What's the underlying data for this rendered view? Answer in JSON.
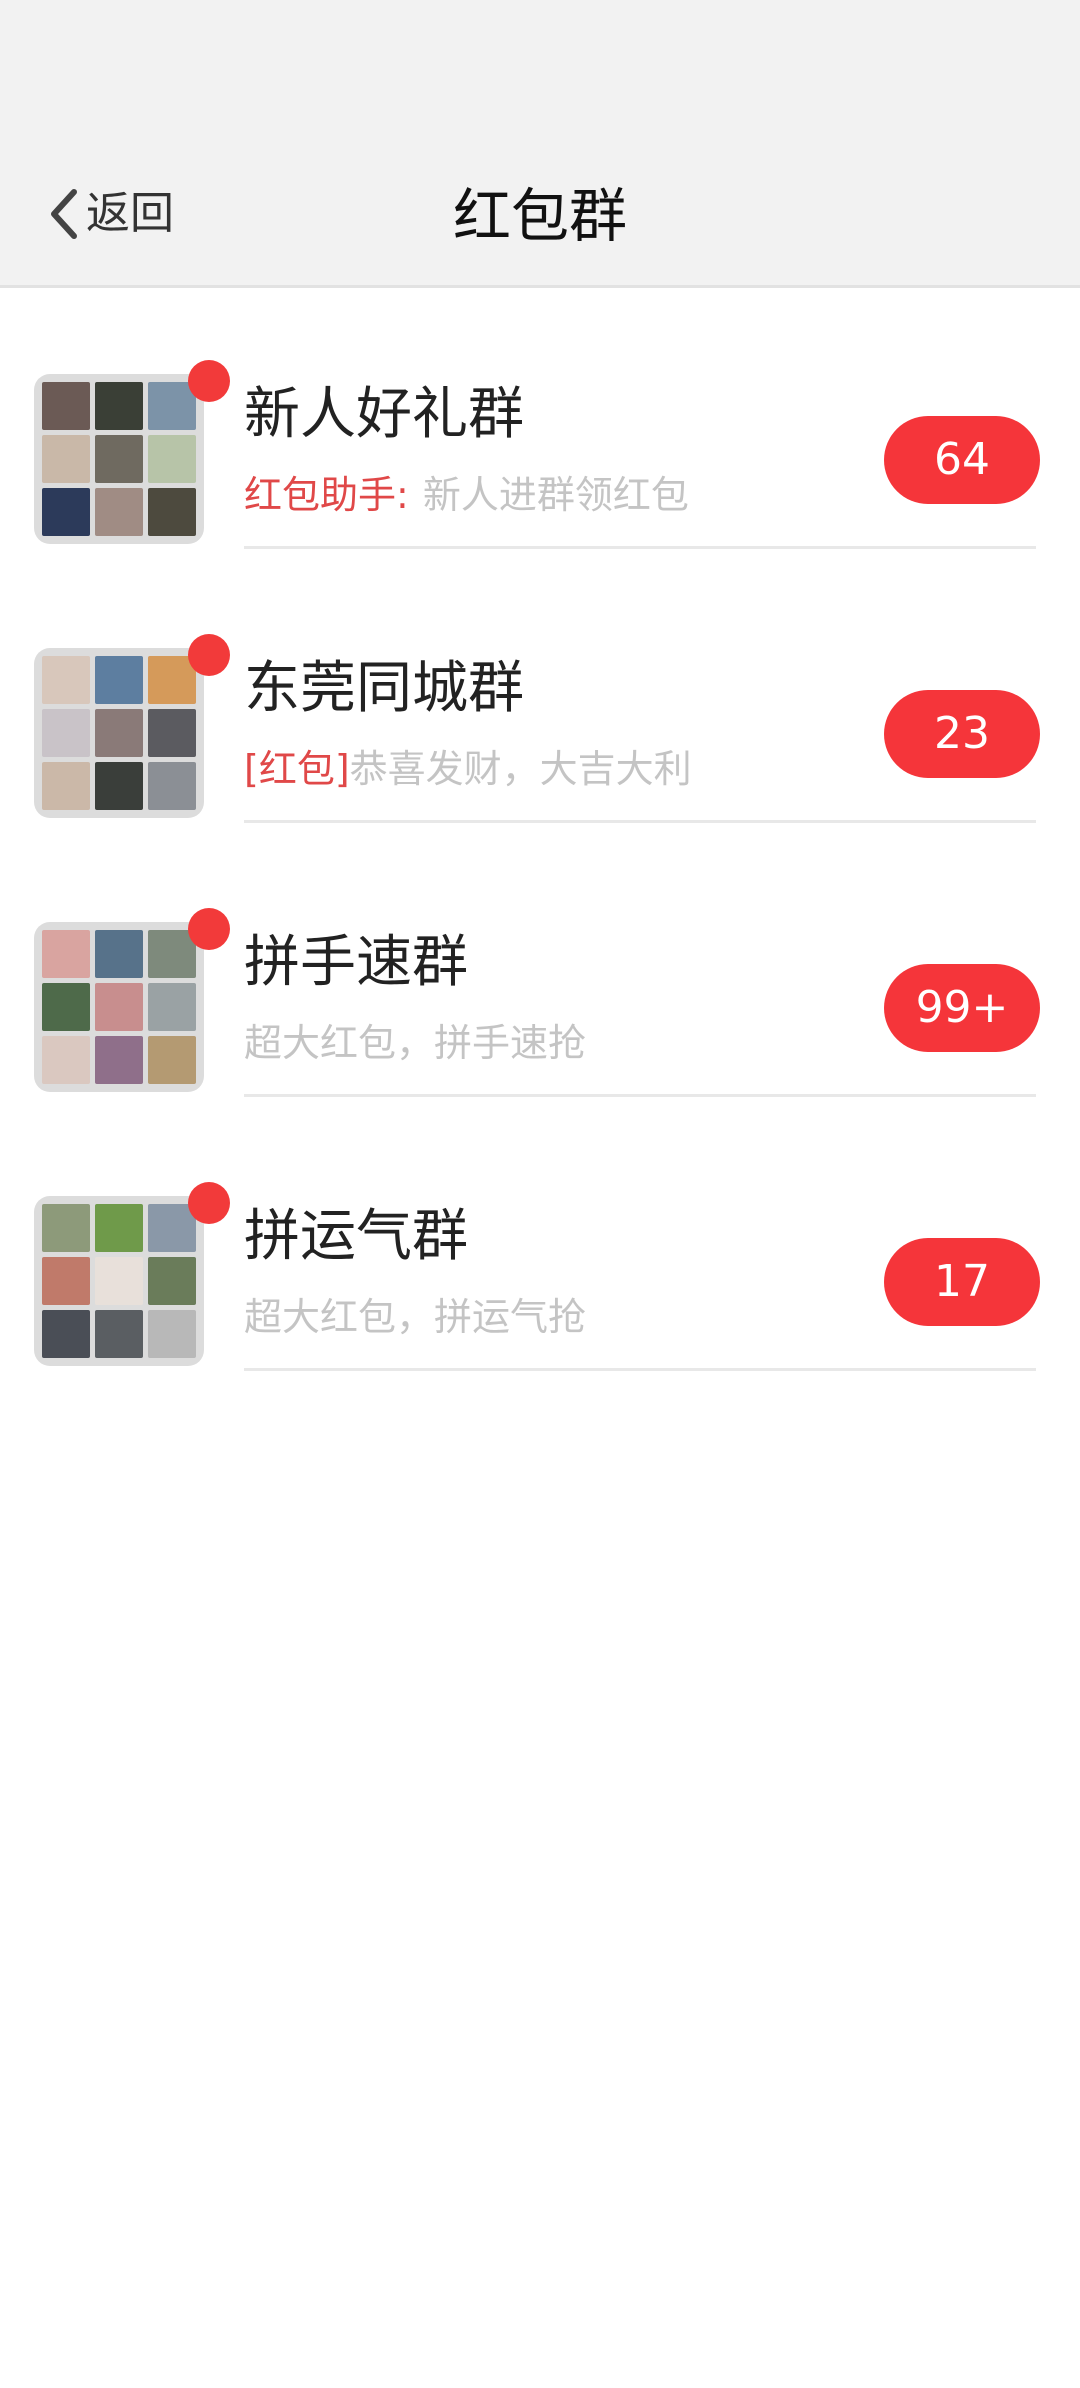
{
  "header": {
    "back_label": "返回",
    "title": "红包群"
  },
  "groups": [
    {
      "name": "新人好礼群",
      "preview_prefix": "红包助手:",
      "preview_text": "新人进群领红包",
      "badge": "64",
      "avatar_colors": [
        "#6b5a55",
        "#3a3f36",
        "#7c93a8",
        "#c9b8a8",
        "#6f6a60",
        "#b7c4a8",
        "#2c3a5a",
        "#a08c84",
        "#4d4a3e"
      ]
    },
    {
      "name": "东莞同城群",
      "preview_prefix": "[红包]",
      "preview_text": "恭喜发财，大吉大利",
      "badge": "23",
      "avatar_colors": [
        "#d8c7bb",
        "#5d7ea0",
        "#d59a5a",
        "#c9c3c8",
        "#8a7a78",
        "#5b5b60",
        "#cbb8a8",
        "#3a3e3a",
        "#8b8f95"
      ]
    },
    {
      "name": "拼手速群",
      "preview_prefix": "",
      "preview_text": "超大红包，拼手速抢",
      "badge": "99+",
      "avatar_colors": [
        "#d9a4a0",
        "#57728a",
        "#7e8a7c",
        "#4e6a4a",
        "#c88e8e",
        "#9aa2a4",
        "#dac8c0",
        "#8f6f8a",
        "#b49a72"
      ]
    },
    {
      "name": "拼运气群",
      "preview_prefix": "",
      "preview_text": "超大红包，拼运气抢",
      "badge": "17",
      "avatar_colors": [
        "#8d9a7a",
        "#6f9a4a",
        "#8a98a8",
        "#c07a6a",
        "#e8e0da",
        "#6a7c5a",
        "#4a4e56",
        "#5a5e62",
        "#b8b8b8"
      ]
    }
  ]
}
